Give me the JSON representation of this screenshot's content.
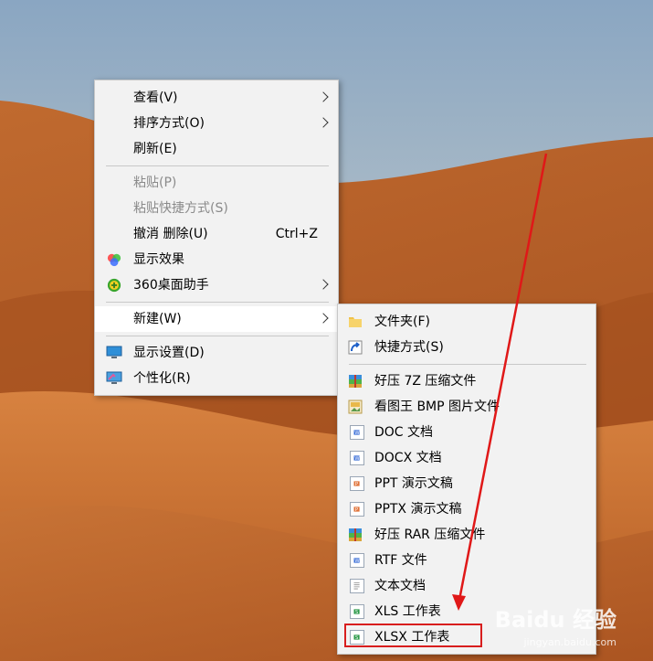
{
  "context_menu": {
    "items": [
      {
        "label": "查看(V)"
      },
      {
        "label": "排序方式(O)"
      },
      {
        "label": "刷新(E)"
      },
      {
        "label": "粘贴(P)"
      },
      {
        "label": "粘贴快捷方式(S)"
      },
      {
        "label": "撤消 删除(U)",
        "shortcut": "Ctrl+Z"
      },
      {
        "label": "显示效果"
      },
      {
        "label": "360桌面助手"
      },
      {
        "label": "新建(W)"
      },
      {
        "label": "显示设置(D)"
      },
      {
        "label": "个性化(R)"
      }
    ]
  },
  "new_submenu": {
    "items": [
      {
        "label": "文件夹(F)",
        "icon": "folder-icon"
      },
      {
        "label": "快捷方式(S)",
        "icon": "shortcut-icon"
      },
      {
        "label": "好压 7Z 压缩文件",
        "icon": "archive-icon"
      },
      {
        "label": "看图王 BMP 图片文件",
        "icon": "bmp-image-icon"
      },
      {
        "label": "DOC 文档",
        "icon": "word-doc-icon"
      },
      {
        "label": "DOCX 文档",
        "icon": "word-doc-icon"
      },
      {
        "label": "PPT 演示文稿",
        "icon": "ppt-icon"
      },
      {
        "label": "PPTX 演示文稿",
        "icon": "ppt-icon"
      },
      {
        "label": "好压 RAR 压缩文件",
        "icon": "archive-icon"
      },
      {
        "label": "RTF 文件",
        "icon": "rtf-icon"
      },
      {
        "label": "文本文档",
        "icon": "text-file-icon"
      },
      {
        "label": "XLS 工作表",
        "icon": "excel-icon"
      },
      {
        "label": "XLSX 工作表",
        "icon": "excel-icon"
      }
    ]
  },
  "watermark": {
    "brand": "Baidu 经验",
    "url": "jingyan.baidu.com"
  },
  "colors": {
    "annotation_red": "#e01818",
    "menu_bg": "#f2f2f2"
  }
}
